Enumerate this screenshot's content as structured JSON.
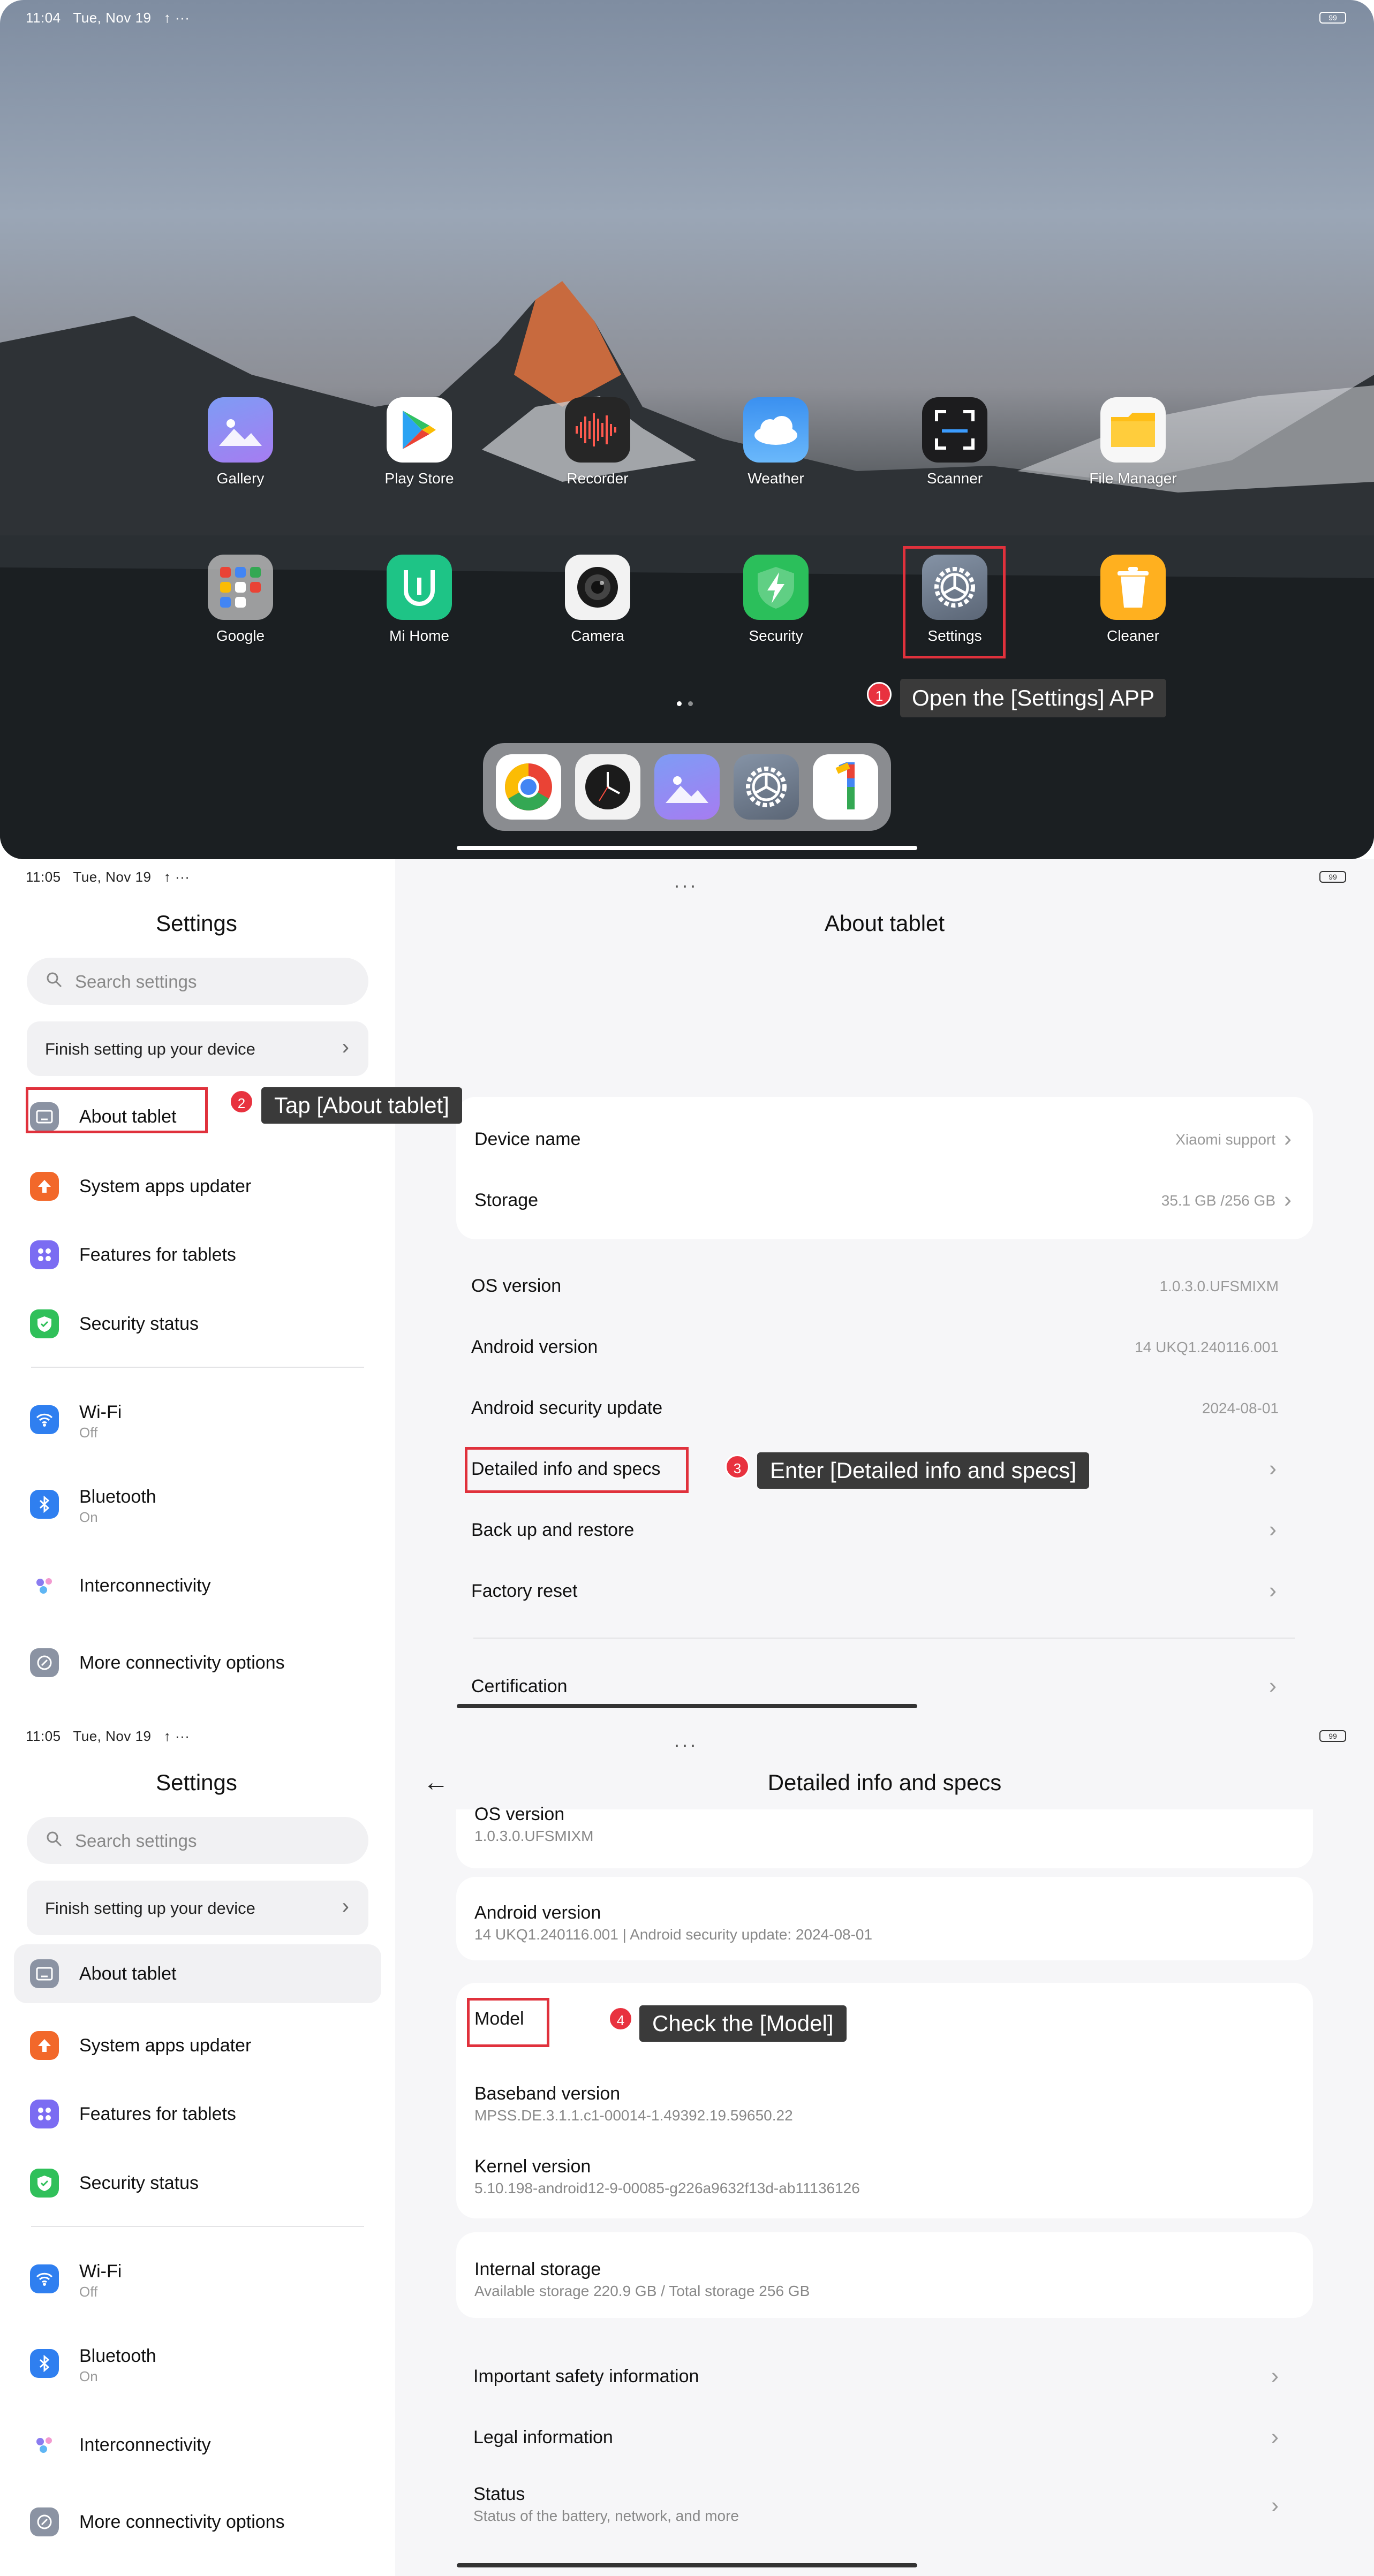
{
  "panel1": {
    "status": {
      "time": "11:04",
      "date": "Tue, Nov 19",
      "extra": "↑ ···",
      "battery": "99"
    },
    "apps_row1": [
      {
        "label": "Gallery",
        "icon": "gallery-icon",
        "color": "#8a7cf0"
      },
      {
        "label": "Play Store",
        "icon": "play-store-icon",
        "color": "#ffffff"
      },
      {
        "label": "Recorder",
        "icon": "recorder-icon",
        "color": "#2a2a2a"
      },
      {
        "label": "Weather",
        "icon": "weather-icon",
        "color": "#3d9af2"
      },
      {
        "label": "Scanner",
        "icon": "scanner-icon",
        "color": "#1c1c1e"
      },
      {
        "label": "File Manager",
        "icon": "file-manager-icon",
        "color": "#ffc31f"
      }
    ],
    "apps_row2": [
      {
        "label": "Google",
        "icon": "google-folder-icon",
        "color": "#b9b9b9"
      },
      {
        "label": "Mi Home",
        "icon": "mi-home-icon",
        "color": "#1fc68a"
      },
      {
        "label": "Camera",
        "icon": "camera-icon",
        "color": "#f4f4f4"
      },
      {
        "label": "Security",
        "icon": "security-icon",
        "color": "#2bbf5b"
      },
      {
        "label": "Settings",
        "icon": "settings-icon",
        "color": "#6f7a89"
      },
      {
        "label": "Cleaner",
        "icon": "cleaner-icon",
        "color": "#ffb51f"
      }
    ],
    "dock": [
      "chrome-icon",
      "clock-icon",
      "gallery-icon",
      "settings-icon",
      "one-icon"
    ],
    "step": "1",
    "tip": "Open the [Settings] APP"
  },
  "sidebar": {
    "title": "Settings",
    "search_placeholder": "Search settings",
    "finish_setup": "Finish setting up your device",
    "items": [
      {
        "label": "About tablet",
        "icon": "tablet-icon",
        "color": "#8b93a3"
      },
      {
        "label": "System apps updater",
        "icon": "update-arrow-icon",
        "color": "#f2682a"
      },
      {
        "label": "Features for tablets",
        "icon": "grid-icon",
        "color": "#7b6cf2"
      },
      {
        "label": "Security status",
        "icon": "shield-check-icon",
        "color": "#30c05a"
      }
    ],
    "items2": [
      {
        "label": "Wi-Fi",
        "sub": "Off",
        "icon": "wifi-icon",
        "color": "#2f7ff0"
      },
      {
        "label": "Bluetooth",
        "sub": "On",
        "icon": "bluetooth-icon",
        "color": "#2f7ff0"
      },
      {
        "label": "Interconnectivity",
        "sub": "",
        "icon": "interconnectivity-icon",
        "color": "#ffffff"
      },
      {
        "label": "More connectivity options",
        "sub": "",
        "icon": "link-icon",
        "color": "#8b93a3"
      }
    ]
  },
  "panel2": {
    "status": {
      "time": "11:05",
      "date": "Tue, Nov 19",
      "extra": "↑ ···",
      "battery": "99"
    },
    "title": "About tablet",
    "device_name": {
      "label": "Device name",
      "value": "Xiaomi support"
    },
    "storage": {
      "label": "Storage",
      "value": "35.1 GB /256 GB"
    },
    "os_version": {
      "label": "OS version",
      "value": "1.0.3.0.UFSMIXM"
    },
    "android_version": {
      "label": "Android version",
      "value": "14 UKQ1.240116.001"
    },
    "security_update": {
      "label": "Android security update",
      "value": "2024-08-01"
    },
    "detailed_info": "Detailed info and specs",
    "backup": "Back up and restore",
    "factory_reset": "Factory reset",
    "certification": "Certification",
    "step2": "2",
    "tip2": "Tap [About tablet]",
    "step3": "3",
    "tip3": "Enter [Detailed info and specs]"
  },
  "panel3": {
    "status": {
      "time": "11:05",
      "date": "Tue, Nov 19",
      "extra": "↑ ···",
      "battery": "99"
    },
    "title": "Detailed info and specs",
    "os_version": {
      "label": "OS version",
      "value": "1.0.3.0.UFSMIXM"
    },
    "android_version": {
      "label": "Android version",
      "value": "14 UKQ1.240116.001 | Android security update: 2024-08-01"
    },
    "model": "Model",
    "baseband": {
      "label": "Baseband version",
      "value": "MPSS.DE.3.1.1.c1-00014-1.49392.19.59650.22"
    },
    "kernel": {
      "label": "Kernel version",
      "value": "5.10.198-android12-9-00085-g226a9632f13d-ab11136126"
    },
    "internal_storage": {
      "label": "Internal storage",
      "value": "Available storage  220.9 GB / Total storage  256 GB"
    },
    "safety": "Important safety information",
    "legal": "Legal information",
    "status_item": {
      "label": "Status",
      "value": "Status of the battery, network, and more"
    },
    "step4": "4",
    "tip4": "Check the [Model]"
  }
}
